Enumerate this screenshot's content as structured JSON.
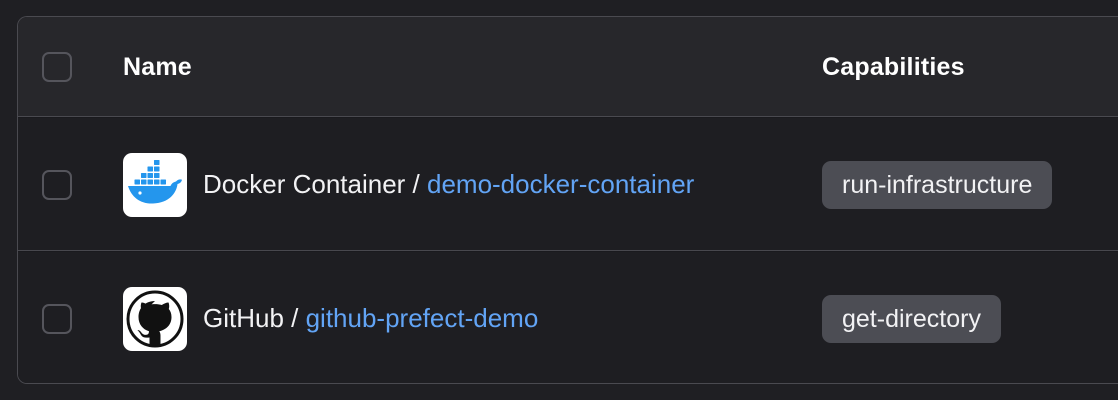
{
  "table": {
    "headers": {
      "name": "Name",
      "capabilities": "Capabilities"
    },
    "rows": [
      {
        "type": "Docker Container",
        "separator": " / ",
        "name": "demo-docker-container",
        "icon": "docker-whale-icon",
        "capability": "run-infrastructure"
      },
      {
        "type": "GitHub",
        "separator": " / ",
        "name": "github-prefect-demo",
        "icon": "github-octocat-icon",
        "capability": "get-directory"
      }
    ]
  },
  "colors": {
    "background": "#1f1f23",
    "header_background": "#27272b",
    "link": "#62a4f5",
    "badge_background": "#4c4d54",
    "docker_blue": "#2496ed"
  }
}
